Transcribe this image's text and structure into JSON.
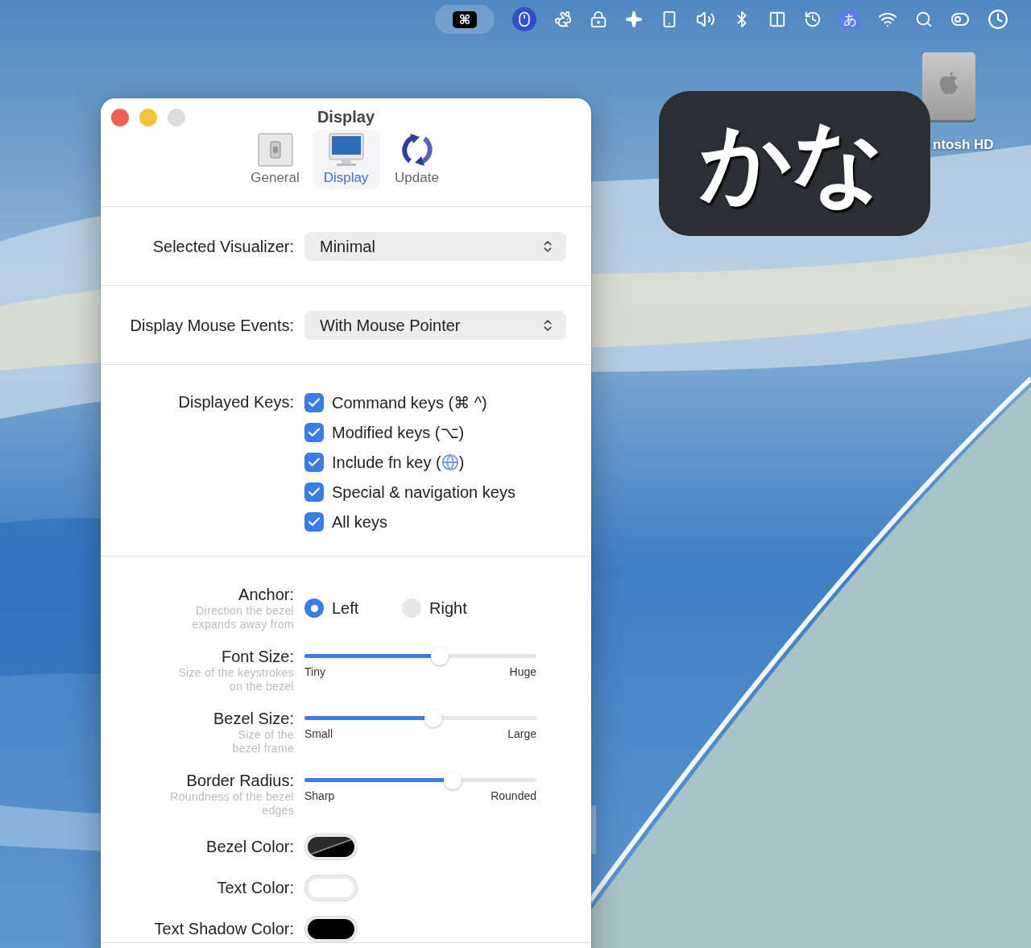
{
  "menu_bar": {
    "command_key": "⌘",
    "input_mode": "あ"
  },
  "desktop": {
    "drive_label": "ntosh HD"
  },
  "bezel": {
    "text": "かな"
  },
  "window": {
    "title": "Display",
    "tabs": [
      {
        "label": "General",
        "selected": false
      },
      {
        "label": "Display",
        "selected": true
      },
      {
        "label": "Update",
        "selected": false
      }
    ],
    "popups": [
      {
        "label": "Selected Visualizer:",
        "value": "Minimal"
      },
      {
        "label": "Display Mouse Events:",
        "value": "With Mouse Pointer"
      }
    ],
    "displayed_keys": {
      "label": "Displayed Keys:",
      "options": [
        {
          "label": "Command keys (⌘ ^)",
          "checked": true
        },
        {
          "label": "Modified keys (⌥)",
          "checked": true
        },
        {
          "label": "Include fn key (",
          "label_end": ")",
          "checked": true
        },
        {
          "label": "Special & navigation keys",
          "checked": true
        },
        {
          "label": "All keys",
          "checked": true
        }
      ]
    },
    "anchor": {
      "label": "Anchor:",
      "hint": [
        "Direction the bezel",
        "expands away from"
      ],
      "options": [
        {
          "label": "Left",
          "selected": true
        },
        {
          "label": "Right",
          "selected": false
        }
      ]
    },
    "sliders": [
      {
        "label": "Font Size:",
        "hint": [
          "Size of the keystrokes",
          "on the bezel"
        ],
        "min_label": "Tiny",
        "max_label": "Huge",
        "level": 0.59
      },
      {
        "label": "Bezel Size:",
        "hint": [
          "Size of the",
          "bezel frame"
        ],
        "min_label": "Small",
        "max_label": "Large",
        "level": 0.56
      },
      {
        "label": "Border Radius:",
        "hint": [
          "Roundness of the bezel",
          "edges"
        ],
        "min_label": "Sharp",
        "max_label": "Rounded",
        "level": 0.65
      }
    ],
    "colors": [
      {
        "label": "Bezel Color:",
        "color": "#2b2b2b",
        "translucent": true
      },
      {
        "label": "Text Color:",
        "color": "#ffffff",
        "translucent": false
      },
      {
        "label": "Text Shadow Color:",
        "color": "#000000",
        "translucent": false
      }
    ]
  }
}
